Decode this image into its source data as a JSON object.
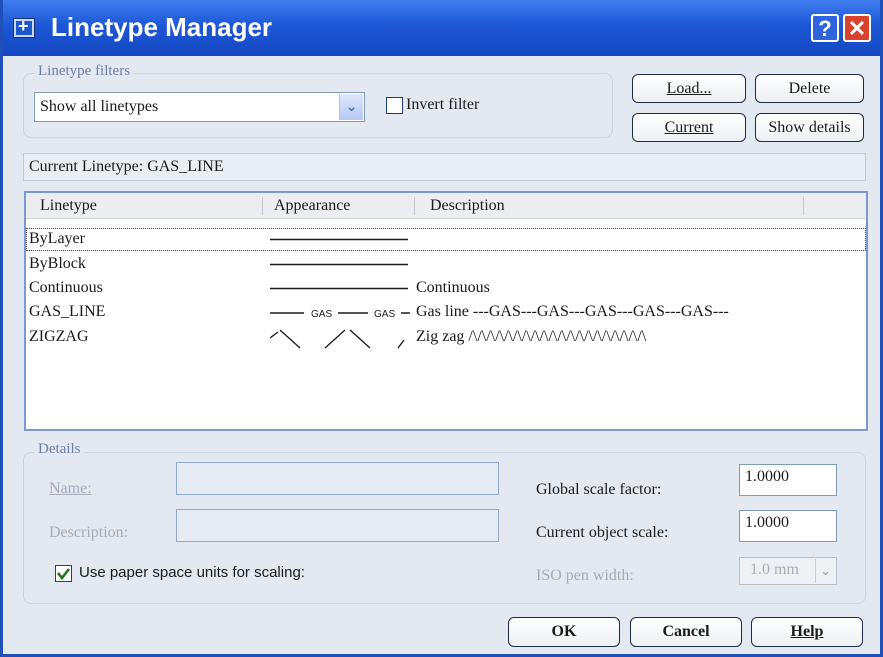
{
  "window": {
    "title": "Linetype Manager",
    "help_glyph": "?",
    "close_glyph": "✕"
  },
  "filters": {
    "group_label": "Linetype filters",
    "selected": "Show all linetypes",
    "invert_label": "Invert filter",
    "invert_checked": false
  },
  "buttons": {
    "load": "Load...",
    "delete": "Delete",
    "current": "Current",
    "show_details": "Show details",
    "ok": "OK",
    "cancel": "Cancel",
    "help": "Help"
  },
  "status": {
    "current_linetype": "Current Linetype: GAS_LINE"
  },
  "table": {
    "headers": [
      "Linetype",
      "Appearance",
      "Description"
    ],
    "rows": [
      {
        "name": "ByLayer",
        "description": "",
        "appearance": "solid"
      },
      {
        "name": "ByBlock",
        "description": "",
        "appearance": "solid"
      },
      {
        "name": "Continuous",
        "description": "Continuous",
        "appearance": "solid"
      },
      {
        "name": "GAS_LINE",
        "description": "Gas line ---GAS---GAS---GAS---GAS---GAS---",
        "appearance": "gas",
        "appearance_text": "GAS"
      },
      {
        "name": "ZIGZAG",
        "description": "Zig zag /\\/\\/\\/\\/\\/\\/\\/\\/\\/\\/\\/\\/\\/\\/\\/\\/\\/\\/\\/\\",
        "appearance": "zigzag"
      }
    ],
    "selected_row": "ByLayer"
  },
  "details": {
    "group_label": "Details",
    "name_label": "Name:",
    "name_value": "",
    "description_label": "Description:",
    "description_value": "",
    "global_scale_label": "Global scale factor:",
    "global_scale_value": "1.0000",
    "object_scale_label": "Current object scale:",
    "object_scale_value": "1.0000",
    "iso_pen_label": "ISO pen width:",
    "iso_pen_value": "1.0 mm",
    "paper_space_label": "Use paper space units for scaling:",
    "paper_space_checked": true
  },
  "colors": {
    "titlebar": "#1d57d6",
    "check": "#1a7a1a"
  }
}
